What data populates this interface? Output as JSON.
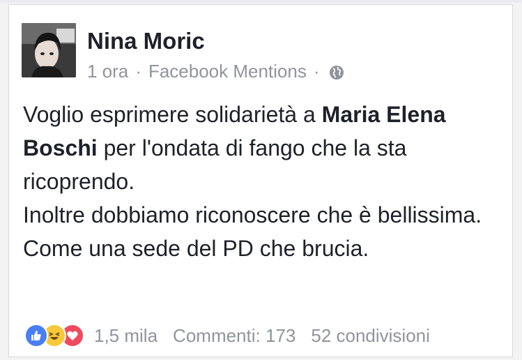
{
  "post": {
    "author": "Nina Moric",
    "time": "1 ora",
    "source": "Facebook Mentions",
    "separator": "·",
    "visibility_icon": "globe-icon",
    "lines": {
      "p1_a": "Voglio esprimere solidarietà a ",
      "p1_bold": "Maria Elena Boschi",
      "p1_b": " per l'ondata di fango che la sta ricoprendo.",
      "p2": "Inoltre dobbiamo riconoscere che è bellissima.",
      "p3": "Come una sede del PD che brucia."
    }
  },
  "footer": {
    "reactions": [
      "like-icon",
      "haha-icon",
      "love-icon"
    ],
    "reaction_count": "1,5 mila",
    "comments": "Commenti: 173",
    "shares": "52 condivisioni"
  },
  "colors": {
    "author": "#1d2129",
    "meta": "#90949c",
    "like": "#4a7ef6",
    "haha": "#f7c83a",
    "love": "#f04a5f"
  }
}
